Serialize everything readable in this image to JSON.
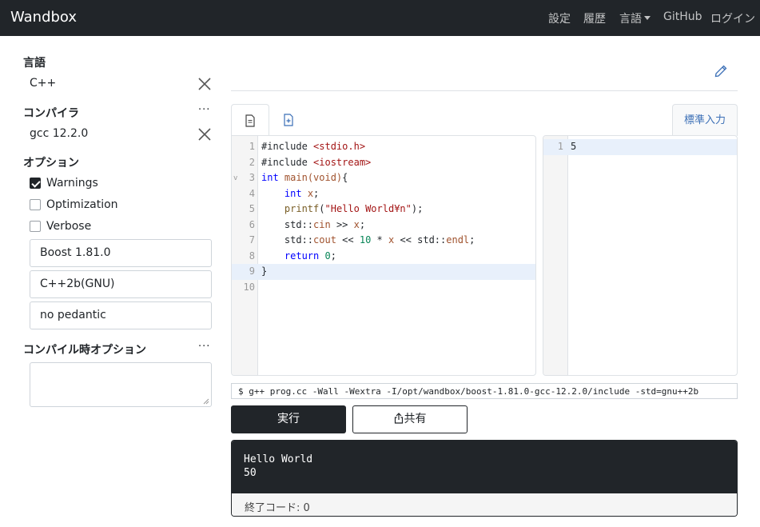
{
  "navbar": {
    "brand": "Wandbox",
    "settings": "設定",
    "history": "履歴",
    "language": "言語",
    "github": "GitHub",
    "login": "ログイン"
  },
  "sidebar": {
    "language_title": "言語",
    "language_value": "C++",
    "compiler_title": "コンパイラ",
    "compiler_value": "gcc 12.2.0",
    "options_title": "オプション",
    "checkboxes": [
      {
        "label": "Warnings",
        "checked": true
      },
      {
        "label": "Optimization",
        "checked": false
      },
      {
        "label": "Verbose",
        "checked": false
      }
    ],
    "selects": [
      "Boost 1.81.0",
      "C++2b(GNU)",
      "no pedantic"
    ],
    "compile_options_title": "コンパイル時オプション",
    "dots": "···"
  },
  "editor": {
    "line_numbers": [
      "1",
      "2",
      "3",
      "4",
      "5",
      "6",
      "7",
      "8",
      "9",
      "10"
    ],
    "highlighted_line": 9,
    "lines": [
      [
        {
          "t": "#include "
        },
        {
          "t": "<stdio.h>",
          "c": "str"
        }
      ],
      [
        {
          "t": "#include "
        },
        {
          "t": "<iostream>",
          "c": "str"
        }
      ],
      [
        {
          "t": "int ",
          "c": "kw"
        },
        {
          "t": "main",
          "c": "id"
        },
        {
          "t": "(void)",
          "c": "id"
        },
        {
          "t": "{"
        }
      ],
      [
        {
          "t": "    "
        },
        {
          "t": "int ",
          "c": "kw"
        },
        {
          "t": "x",
          "c": "id"
        },
        {
          "t": ";"
        }
      ],
      [
        {
          "t": "    "
        },
        {
          "t": "printf",
          "c": "fn"
        },
        {
          "t": "("
        },
        {
          "t": "\"Hello World¥n\"",
          "c": "str"
        },
        {
          "t": ");"
        }
      ],
      [
        {
          "t": "    std::"
        },
        {
          "t": "cin",
          "c": "id"
        },
        {
          "t": " >> "
        },
        {
          "t": "x",
          "c": "id"
        },
        {
          "t": ";"
        }
      ],
      [
        {
          "t": "    std::"
        },
        {
          "t": "cout",
          "c": "id"
        },
        {
          "t": " << "
        },
        {
          "t": "10",
          "c": "num"
        },
        {
          "t": " * "
        },
        {
          "t": "x",
          "c": "id"
        },
        {
          "t": " << std::"
        },
        {
          "t": "endl",
          "c": "id"
        },
        {
          "t": ";"
        }
      ],
      [
        {
          "t": "    "
        },
        {
          "t": "return ",
          "c": "kw"
        },
        {
          "t": "0",
          "c": "num"
        },
        {
          "t": ";"
        }
      ],
      [
        {
          "t": "}"
        }
      ],
      []
    ]
  },
  "stdin": {
    "tab_label": "標準入力",
    "line_number": "1",
    "value": "5"
  },
  "command_line": "$ g++ prog.cc -Wall -Wextra -I/opt/wandbox/boost-1.81.0-gcc-12.2.0/include -std=gnu++2b",
  "buttons": {
    "run": "実行",
    "share": "共有"
  },
  "output": {
    "text": "Hello World\n50",
    "exit_code_label": "終了コード: ",
    "exit_code": "0"
  },
  "colors": {
    "navbar_bg": "#212529",
    "accent": "#3b6fb6",
    "highlight_line": "#e8f0fb"
  }
}
